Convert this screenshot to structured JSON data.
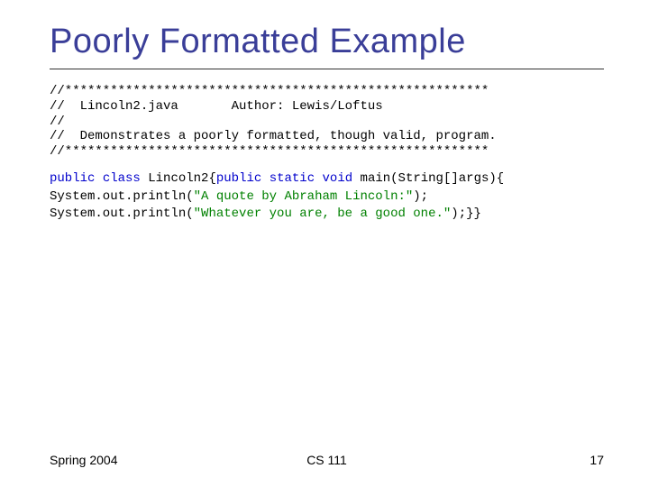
{
  "title": "Poorly Formatted Example",
  "comment": {
    "l1": "//********************************************************",
    "l2": "//  Lincoln2.java       Author: Lewis/Loftus",
    "l3": "//",
    "l4": "//  Demonstrates a poorly formatted, though valid, program.",
    "l5": "//********************************************************"
  },
  "code": {
    "kw_public1": "public",
    "sp1": " ",
    "kw_class": "class",
    "sp2": " ",
    "classname": "Lincoln2{",
    "kw_public2": "public",
    "sp3": " ",
    "kw_static": "static",
    "sp4": " ",
    "kw_void": "void",
    "sp5": " ",
    "mainhead": "main(String[]args){",
    "line2a": "System.out.println(",
    "str1": "\"A quote by Abraham Lincoln:\"",
    "line2b": ");",
    "line3a": "System.out.println(",
    "str2": "\"Whatever you are, be a good one.\"",
    "line3b": ");}}"
  },
  "footer": {
    "left": "Spring 2004",
    "center": "CS 111",
    "right": "17"
  }
}
